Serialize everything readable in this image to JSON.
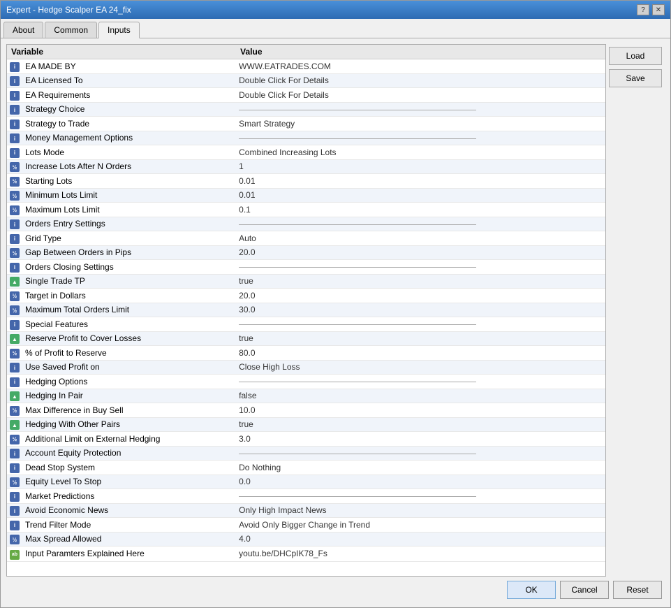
{
  "window": {
    "title": "Expert - Hedge Scalper EA 24_fix",
    "help_btn": "?",
    "close_btn": "✕"
  },
  "tabs": [
    {
      "id": "about",
      "label": "About",
      "active": false
    },
    {
      "id": "common",
      "label": "Common",
      "active": false
    },
    {
      "id": "inputs",
      "label": "Inputs",
      "active": true
    }
  ],
  "table": {
    "col_variable": "Variable",
    "col_value": "Value",
    "rows": [
      {
        "icon": "i",
        "variable": "EA MADE BY",
        "value": "WWW.EATRADES.COM",
        "type": "data"
      },
      {
        "icon": "i",
        "variable": "EA Licensed To",
        "value": "Double Click For Details",
        "type": "data"
      },
      {
        "icon": "i",
        "variable": "EA Requirements",
        "value": "Double Click For Details",
        "type": "data"
      },
      {
        "icon": "i",
        "variable": "Strategy Choice",
        "value": "",
        "type": "separator"
      },
      {
        "icon": "i",
        "variable": "Strategy to Trade",
        "value": "Smart Strategy",
        "type": "data"
      },
      {
        "icon": "i",
        "variable": "Money Management Options",
        "value": "",
        "type": "separator"
      },
      {
        "icon": "i",
        "variable": "Lots Mode",
        "value": "Combined Increasing Lots",
        "type": "data"
      },
      {
        "icon": "v",
        "variable": "Increase Lots After N Orders",
        "value": "1",
        "type": "data"
      },
      {
        "icon": "v",
        "variable": "Starting Lots",
        "value": "0.01",
        "type": "data"
      },
      {
        "icon": "v",
        "variable": "Minimum Lots Limit",
        "value": "0.01",
        "type": "data"
      },
      {
        "icon": "v",
        "variable": "Maximum Lots Limit",
        "value": "0.1",
        "type": "data"
      },
      {
        "icon": "i",
        "variable": "Orders Entry Settings",
        "value": "",
        "type": "separator"
      },
      {
        "icon": "i",
        "variable": "Grid Type",
        "value": "Auto",
        "type": "data"
      },
      {
        "icon": "v",
        "variable": "Gap Between Orders in Pips",
        "value": "20.0",
        "type": "data"
      },
      {
        "icon": "i",
        "variable": "Orders Closing Settings",
        "value": "",
        "type": "separator"
      },
      {
        "icon": "tri",
        "variable": "Single Trade TP",
        "value": "true",
        "type": "data"
      },
      {
        "icon": "v",
        "variable": "Target in Dollars",
        "value": "20.0",
        "type": "data"
      },
      {
        "icon": "v",
        "variable": "Maximum Total Orders Limit",
        "value": "30.0",
        "type": "data"
      },
      {
        "icon": "i",
        "variable": "Special Features",
        "value": "",
        "type": "separator"
      },
      {
        "icon": "tri",
        "variable": "Reserve Profit to Cover Losses",
        "value": "true",
        "type": "data"
      },
      {
        "icon": "v",
        "variable": "% of Profit to Reserve",
        "value": "80.0",
        "type": "data"
      },
      {
        "icon": "i",
        "variable": "Use Saved Profit on",
        "value": "Close High Loss",
        "type": "data"
      },
      {
        "icon": "i",
        "variable": "Hedging Options",
        "value": "",
        "type": "separator"
      },
      {
        "icon": "tri",
        "variable": "Hedging In Pair",
        "value": "false",
        "type": "data"
      },
      {
        "icon": "v",
        "variable": "Max Difference in Buy Sell",
        "value": "10.0",
        "type": "data"
      },
      {
        "icon": "tri",
        "variable": "Hedging With Other Pairs",
        "value": "true",
        "type": "data"
      },
      {
        "icon": "v",
        "variable": "Additional Limit on External Hedging",
        "value": "3.0",
        "type": "data"
      },
      {
        "icon": "i",
        "variable": "Account Equity Protection",
        "value": "",
        "type": "separator"
      },
      {
        "icon": "i",
        "variable": "Dead Stop System",
        "value": "Do Nothing",
        "type": "data"
      },
      {
        "icon": "v",
        "variable": "Equity Level To Stop",
        "value": "0.0",
        "type": "data"
      },
      {
        "icon": "i",
        "variable": "Market Predictions",
        "value": "",
        "type": "section"
      },
      {
        "icon": "i",
        "variable": "Avoid Economic News",
        "value": "Only High Impact News",
        "type": "data"
      },
      {
        "icon": "i",
        "variable": "Trend Filter Mode",
        "value": "Avoid Only Bigger Change in Trend",
        "type": "data"
      },
      {
        "icon": "v",
        "variable": "Max Spread Allowed",
        "value": "4.0",
        "type": "data"
      },
      {
        "icon": "ab",
        "variable": "Input Paramters Explained Here",
        "value": "youtu.be/DHCpIK78_Fs",
        "type": "data"
      }
    ]
  },
  "buttons": {
    "load": "Load",
    "save": "Save",
    "ok": "OK",
    "cancel": "Cancel",
    "reset": "Reset"
  }
}
